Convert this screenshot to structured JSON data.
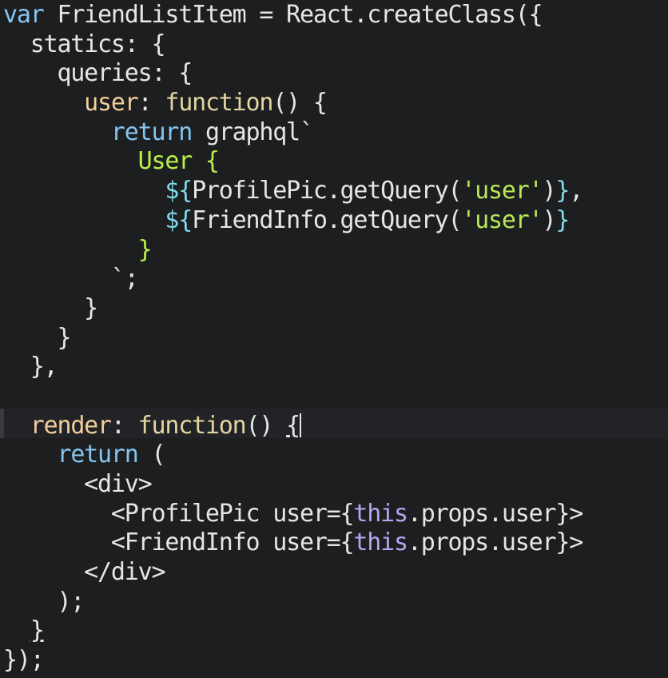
{
  "editor": {
    "lines": [
      [
        {
          "t": "var",
          "c": "kw"
        },
        {
          "t": " FriendListItem = React.createClass({",
          "c": "plain"
        }
      ],
      [
        {
          "t": "  statics: {",
          "c": "plain"
        }
      ],
      [
        {
          "t": "    queries: {",
          "c": "plain"
        }
      ],
      [
        {
          "t": "      ",
          "c": "plain"
        },
        {
          "t": "user",
          "c": "prop"
        },
        {
          "t": ": ",
          "c": "plain"
        },
        {
          "t": "function",
          "c": "fn"
        },
        {
          "t": "() {",
          "c": "plain"
        }
      ],
      [
        {
          "t": "        ",
          "c": "plain"
        },
        {
          "t": "return",
          "c": "kw"
        },
        {
          "t": " graphql`",
          "c": "plain"
        }
      ],
      [
        {
          "t": "          ",
          "c": "plain"
        },
        {
          "t": "User {",
          "c": "gql"
        }
      ],
      [
        {
          "t": "            ",
          "c": "plain"
        },
        {
          "t": "${",
          "c": "tpl"
        },
        {
          "t": "ProfilePic.getQuery(",
          "c": "plain"
        },
        {
          "t": "'user'",
          "c": "str"
        },
        {
          "t": ")",
          "c": "plain"
        },
        {
          "t": "}",
          "c": "tpl"
        },
        {
          "t": ",",
          "c": "plain"
        }
      ],
      [
        {
          "t": "            ",
          "c": "plain"
        },
        {
          "t": "${",
          "c": "tpl"
        },
        {
          "t": "FriendInfo.getQuery(",
          "c": "plain"
        },
        {
          "t": "'user'",
          "c": "str"
        },
        {
          "t": ")",
          "c": "plain"
        },
        {
          "t": "}",
          "c": "tpl"
        }
      ],
      [
        {
          "t": "          ",
          "c": "plain"
        },
        {
          "t": "}",
          "c": "gql"
        }
      ],
      [
        {
          "t": "        `;",
          "c": "plain"
        }
      ],
      [
        {
          "t": "      }",
          "c": "plain"
        }
      ],
      [
        {
          "t": "    }",
          "c": "plain"
        }
      ],
      [
        {
          "t": "  },",
          "c": "plain"
        }
      ],
      [
        {
          "t": "",
          "c": "plain"
        }
      ],
      [
        {
          "t": "  ",
          "c": "plain"
        },
        {
          "t": "render",
          "c": "prop"
        },
        {
          "t": ": ",
          "c": "plain"
        },
        {
          "t": "function",
          "c": "fn"
        },
        {
          "t": "() ",
          "c": "plain"
        },
        {
          "t": "{",
          "c": "plain",
          "hl": true
        },
        {
          "t": "",
          "c": "plain",
          "cursor": true
        }
      ],
      [
        {
          "t": "    ",
          "c": "plain"
        },
        {
          "t": "return",
          "c": "kw"
        },
        {
          "t": " (",
          "c": "plain"
        }
      ],
      [
        {
          "t": "      <div>",
          "c": "tag"
        }
      ],
      [
        {
          "t": "        <ProfilePic user={",
          "c": "tag"
        },
        {
          "t": "this",
          "c": "this"
        },
        {
          "t": ".props.user}>",
          "c": "tag"
        }
      ],
      [
        {
          "t": "        <FriendInfo user={",
          "c": "tag"
        },
        {
          "t": "this",
          "c": "this"
        },
        {
          "t": ".props.user}>",
          "c": "tag"
        }
      ],
      [
        {
          "t": "      </div>",
          "c": "tag"
        }
      ],
      [
        {
          "t": "    );",
          "c": "plain"
        }
      ],
      [
        {
          "t": "  ",
          "c": "plain"
        },
        {
          "t": "}",
          "c": "plain",
          "hl": true
        }
      ],
      [
        {
          "t": "});",
          "c": "plain"
        }
      ]
    ]
  }
}
